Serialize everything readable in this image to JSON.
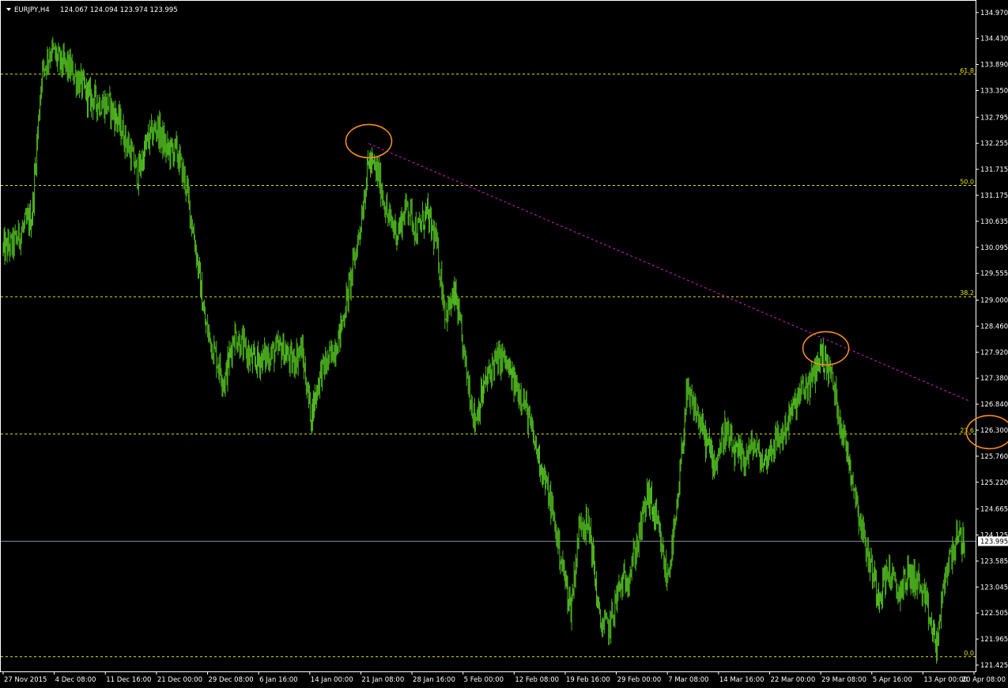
{
  "header": {
    "symbol": "EURJPY,H4",
    "ohlc": "124.067 124.094 123.974 123.995",
    "menu_arrow_icon": "triangle-down-icon"
  },
  "colors": {
    "background": "#000000",
    "candle": "#4fb81f",
    "fib_line": "#e6e600",
    "trendline": "#d020d0",
    "ellipse": "#f28a1e",
    "price_line": "#7f8f9f",
    "axis": "#ffffff",
    "current_price_bg": "#ffffff",
    "current_price_fg": "#000000"
  },
  "chart_data": {
    "type": "line",
    "title": "EURJPY,H4",
    "xlabel": "",
    "ylabel": "",
    "ylim": [
      121.31,
      135.18
    ],
    "grid": false,
    "y_ticks": [
      "134.970",
      "134.430",
      "133.890",
      "133.350",
      "132.795",
      "132.255",
      "131.715",
      "131.175",
      "130.635",
      "130.095",
      "129.555",
      "129.000",
      "128.460",
      "127.920",
      "127.380",
      "126.840",
      "126.300",
      "125.760",
      "125.220",
      "124.665",
      "124.125",
      "123.585",
      "123.045",
      "122.505",
      "121.965",
      "121.425"
    ],
    "x_ticks": [
      "27 Nov 2015",
      "4 Dec 08:00",
      "11 Dec 16:00",
      "21 Dec 00:00",
      "29 Dec 08:00",
      "6 Jan 16:00",
      "14 Jan 00:00",
      "21 Jan 08:00",
      "28 Jan 16:00",
      "5 Feb 00:00",
      "12 Feb 08:00",
      "19 Feb 16:00",
      "29 Feb 00:00",
      "7 Mar 08:00",
      "14 Mar 16:00",
      "22 Mar 00:00",
      "29 Mar 08:00",
      "5 Apr 16:00",
      "13 Apr 00:00",
      "20 Apr 08:00"
    ],
    "series": [
      {
        "name": "EURJPY,H4",
        "x": [
          0,
          1,
          2,
          3,
          4,
          5,
          6,
          7,
          8,
          9,
          10,
          11,
          12,
          13,
          14,
          15,
          16,
          17,
          18,
          19,
          20,
          21,
          22,
          23,
          24,
          25,
          26,
          27,
          28,
          29,
          30,
          31,
          32,
          33,
          34,
          35,
          36,
          37,
          38,
          39,
          40,
          41,
          42,
          43,
          44,
          45,
          46,
          47,
          48,
          49,
          50,
          51,
          52,
          53,
          54,
          55,
          56,
          57,
          58,
          59,
          60,
          61,
          62,
          63,
          64,
          65,
          66,
          67,
          68,
          69,
          70,
          71,
          72,
          73,
          74,
          75,
          76,
          77,
          78,
          79,
          80,
          81,
          82,
          83,
          84,
          85,
          86,
          87,
          88,
          89,
          90,
          91,
          92,
          93,
          94,
          95,
          96,
          97,
          98,
          99,
          100
        ],
        "values": [
          130.05,
          130.15,
          130.45,
          130.75,
          133.7,
          134.2,
          133.9,
          133.8,
          133.5,
          133.2,
          133.1,
          133.05,
          132.7,
          132.2,
          131.6,
          132.3,
          132.6,
          132.1,
          132.1,
          131.4,
          130.1,
          128.5,
          127.9,
          127.3,
          128.3,
          128.0,
          127.7,
          127.8,
          127.9,
          128.0,
          127.7,
          128.0,
          126.6,
          127.5,
          127.8,
          128.3,
          129.3,
          130.4,
          131.9,
          131.6,
          130.7,
          130.4,
          131.0,
          130.4,
          130.8,
          130.2,
          128.7,
          129.1,
          127.7,
          126.5,
          127.2,
          127.7,
          127.8,
          127.3,
          127.0,
          126.2,
          125.5,
          124.7,
          123.6,
          122.6,
          124.5,
          124.2,
          122.3,
          122.2,
          123.0,
          123.3,
          124.0,
          125.0,
          124.3,
          123.2,
          124.5,
          127.0,
          126.7,
          126.1,
          125.6,
          126.3,
          125.8,
          125.7,
          126.0,
          125.6,
          126.0,
          126.2,
          126.7,
          127.1,
          127.3,
          127.9,
          127.5,
          126.5,
          125.6,
          124.5,
          123.6,
          122.9,
          123.4,
          122.9,
          123.3,
          123.2,
          122.6,
          121.8,
          123.4,
          124.0,
          124.0
        ]
      }
    ],
    "fibonacci": [
      {
        "label": "61.8",
        "value": 133.69
      },
      {
        "label": "50.0",
        "value": 131.38
      },
      {
        "label": "38.2",
        "value": 129.07
      },
      {
        "label": "23.6",
        "value": 126.22
      },
      {
        "label": "0.0",
        "value": 121.6
      }
    ],
    "trendline": {
      "start": {
        "x": 38,
        "y": 132.25
      },
      "end": {
        "x": 100.5,
        "y": 126.9
      }
    },
    "highlight_circles": [
      {
        "name": "late-jan-high",
        "x": 38,
        "y": 132.3
      },
      {
        "name": "late-mar-high",
        "x": 85.5,
        "y": 128.0
      },
      {
        "name": "fib-23.6-trendline-target",
        "x": 102.5,
        "y": 126.26
      }
    ],
    "current_price": "123.995",
    "current_price_value": 123.995
  }
}
